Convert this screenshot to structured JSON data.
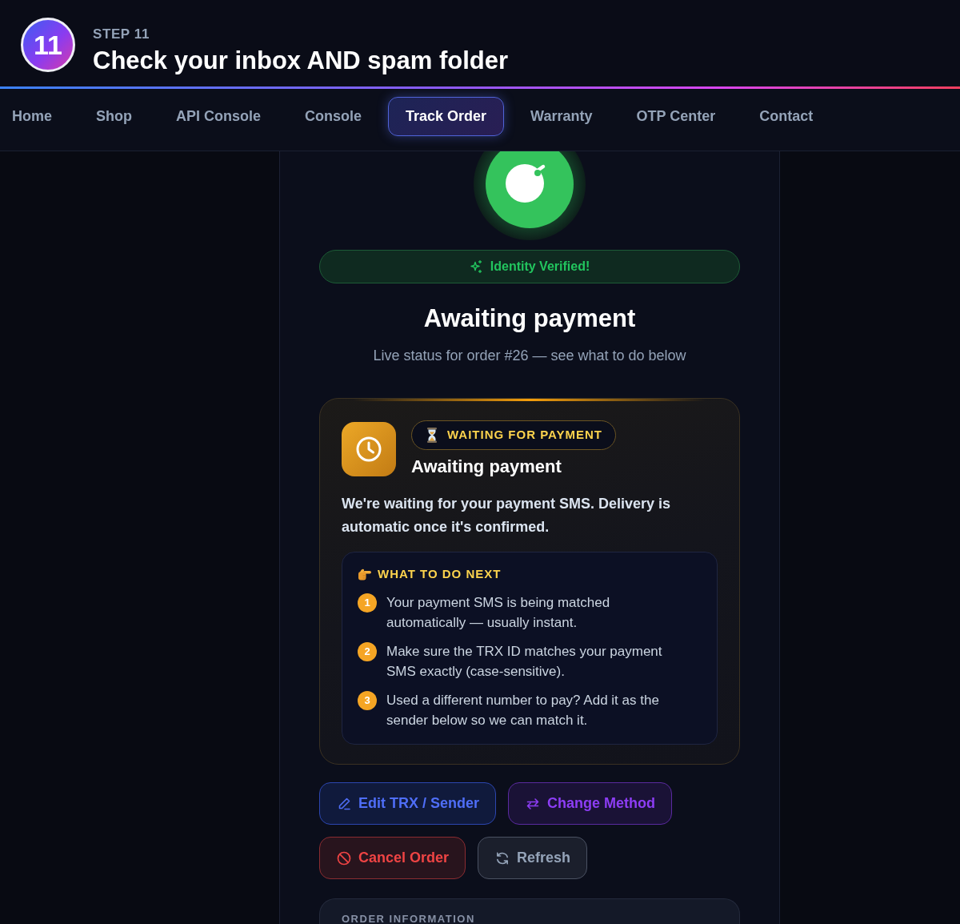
{
  "header": {
    "step_number": "11",
    "step_label": "STEP 11",
    "title": "Check your inbox AND spam folder"
  },
  "nav": [
    {
      "label": "Home",
      "selected": false
    },
    {
      "label": "Shop",
      "selected": false
    },
    {
      "label": "API Console",
      "selected": false
    },
    {
      "label": "Console",
      "selected": false
    },
    {
      "label": "Track Order",
      "selected": true
    },
    {
      "label": "Warranty",
      "selected": false
    },
    {
      "label": "OTP Center",
      "selected": false
    },
    {
      "label": "Contact",
      "selected": false
    }
  ],
  "verification": {
    "label": "Identity Verified!"
  },
  "status": {
    "title": "Awaiting payment",
    "subtitle": "Live status for order #26 — see what to do below"
  },
  "status_card": {
    "badge": "WAITING FOR PAYMENT",
    "title": "Awaiting payment",
    "message": "We're waiting for your payment SMS. Delivery is automatic once it's confirmed.",
    "next_steps": {
      "title": "WHAT TO DO NEXT",
      "items": [
        {
          "number": "1",
          "text": "Your payment SMS is being matched automatically — usually instant."
        },
        {
          "number": "2",
          "text": "Make sure the TRX ID matches your payment SMS exactly (case-sensitive)."
        },
        {
          "number": "3",
          "text": "Used a different number to pay? Add it as the sender below so we can match it."
        }
      ]
    }
  },
  "actions": [
    {
      "label": "Edit TRX / Sender",
      "kind": "edit"
    },
    {
      "label": "Change Method",
      "kind": "switch"
    },
    {
      "label": "Cancel Order",
      "kind": "cancel"
    },
    {
      "label": "Refresh",
      "kind": "refresh"
    }
  ],
  "order_information": {
    "title": "ORDER INFORMATION"
  }
}
